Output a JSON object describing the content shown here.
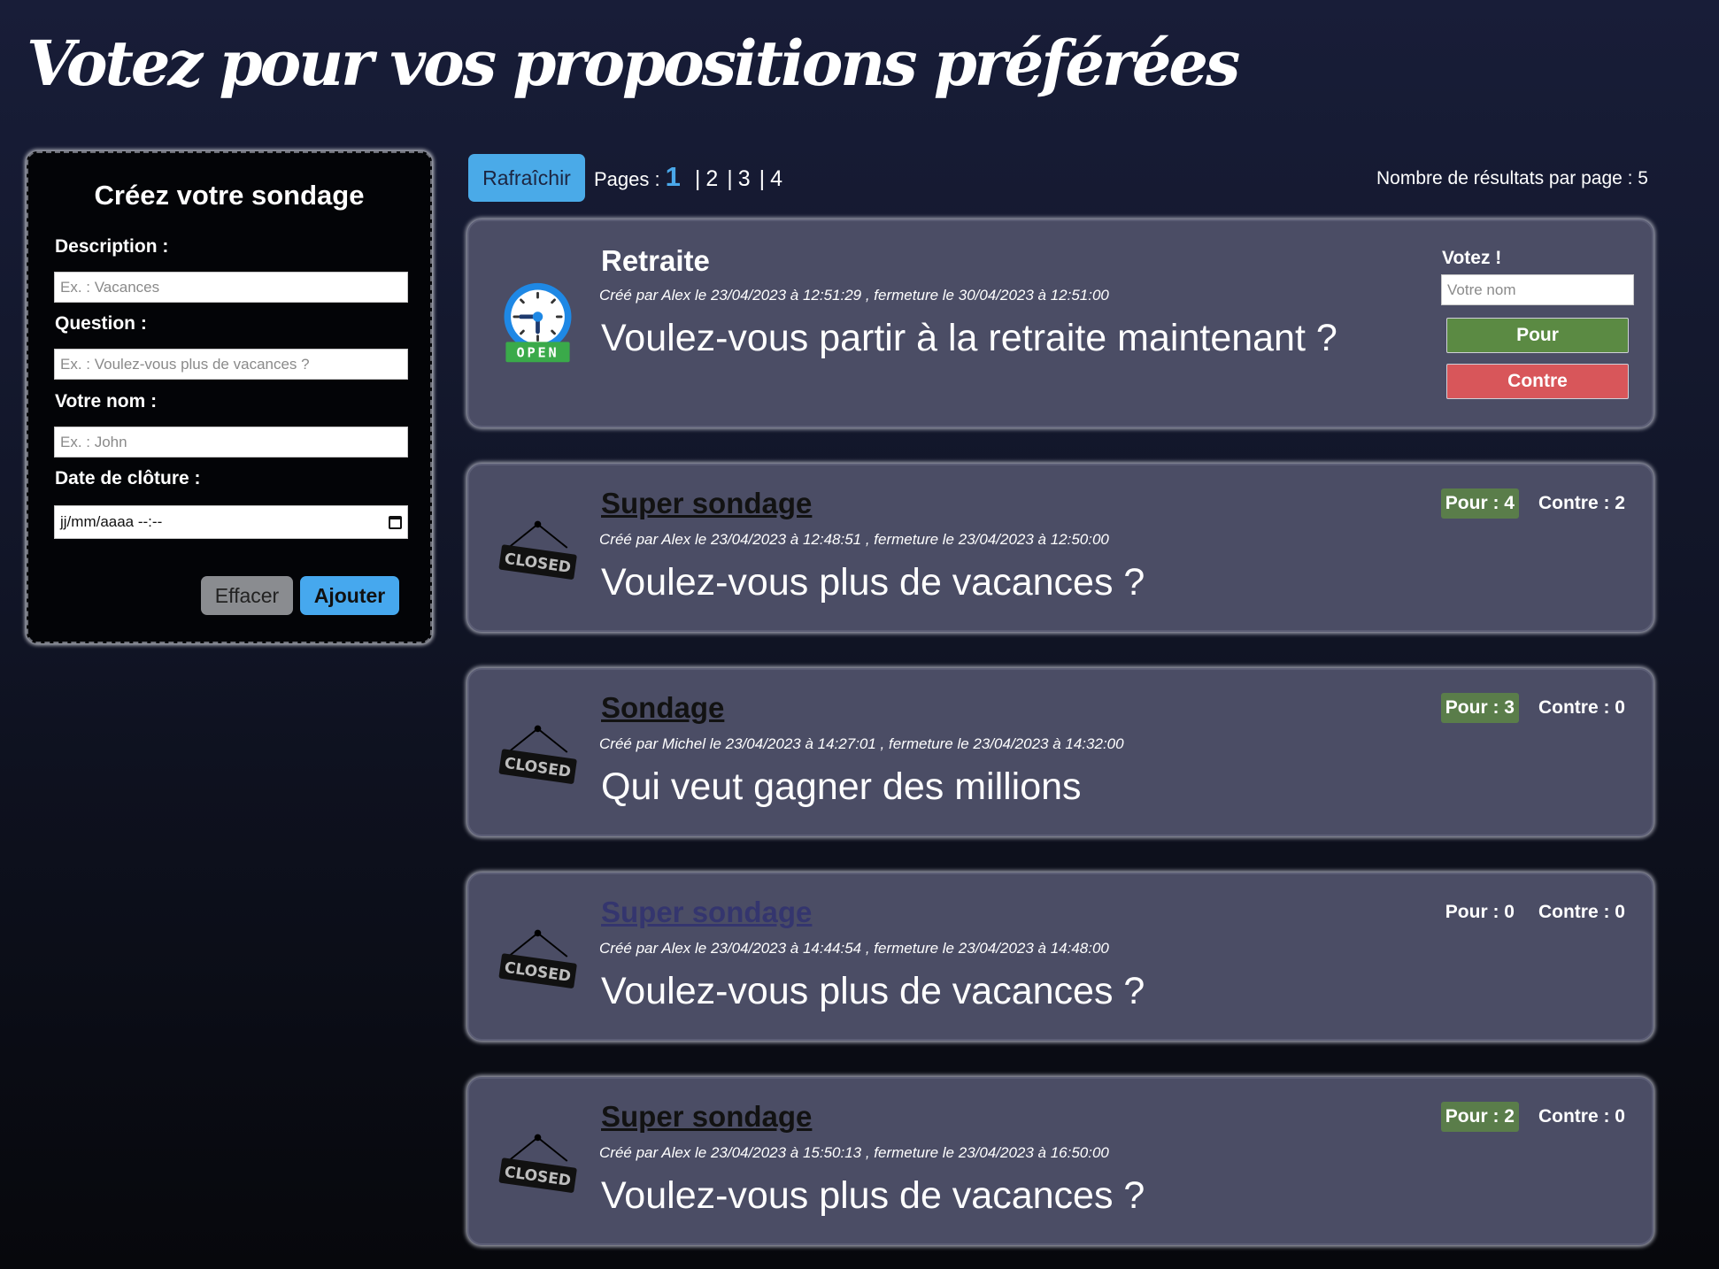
{
  "page": {
    "title": "Votez pour vos propositions préférées"
  },
  "create_form": {
    "title": "Créez votre sondage",
    "description_label": "Description :",
    "description_placeholder": "Ex. : Vacances",
    "question_label": "Question :",
    "question_placeholder": "Ex. : Voulez-vous plus de vacances ?",
    "name_label": "Votre nom :",
    "name_placeholder": "Ex. : John",
    "date_label": "Date de clôture :",
    "date_value": "jj/mm/aaaa --:--",
    "clear_label": "Effacer",
    "add_label": "Ajouter"
  },
  "toolbar": {
    "refresh_label": "Rafraîchir",
    "pages_label": "Pages :",
    "current_page": "1",
    "other_pages": [
      "2",
      "3",
      "4"
    ],
    "separator": "|",
    "per_page_text": "Nombre de résultats par page : 5"
  },
  "polls": [
    {
      "status": "open",
      "status_text": "OPEN",
      "title": "Retraite",
      "meta": "Créé par  Alex  le  23/04/2023 à 12:51:29 , fermeture le  30/04/2023 à 12:51:00",
      "question": "Voulez-vous partir à la retraite maintenant ?",
      "vote_label": "Votez !",
      "vote_placeholder": "Votre nom",
      "pour_button": "Pour",
      "contre_button": "Contre"
    },
    {
      "status": "closed",
      "status_text": "CLOSED",
      "title": "Super sondage",
      "meta": "Créé par  Alex  le  23/04/2023 à 12:48:51 , fermeture le  23/04/2023 à 12:50:00",
      "question": "Voulez-vous plus de vacances ?",
      "pour_text": "Pour : 4",
      "contre_text": "Contre : 2"
    },
    {
      "status": "closed",
      "status_text": "CLOSED",
      "title": "Sondage",
      "meta": "Créé par  Michel  le  23/04/2023 à 14:27:01 , fermeture le  23/04/2023 à 14:32:00",
      "question": "Qui veut gagner des millions",
      "pour_text": "Pour : 3",
      "contre_text": "Contre : 0"
    },
    {
      "status": "closed",
      "status_text": "CLOSED",
      "title": "Super sondage",
      "meta": "Créé par  Alex  le  23/04/2023 à 14:44:54 , fermeture le  23/04/2023 à 14:48:00",
      "question": "Voulez-vous plus de vacances ?",
      "pour_text": "Pour : 0",
      "contre_text": "Contre : 0"
    },
    {
      "status": "closed",
      "status_text": "CLOSED",
      "title": "Super sondage",
      "meta": "Créé par  Alex  le  23/04/2023 à 15:50:13 , fermeture le  23/04/2023 à 16:50:00",
      "question": "Voulez-vous plus de vacances ?",
      "pour_text": "Pour : 2",
      "contre_text": "Contre : 0"
    }
  ],
  "colors": {
    "accent_blue": "#4aaae8",
    "pour_green": "#5b8a43",
    "contre_red": "#d8565a",
    "card_bg": "#4b4d65",
    "open_green": "#3aaa4a"
  }
}
